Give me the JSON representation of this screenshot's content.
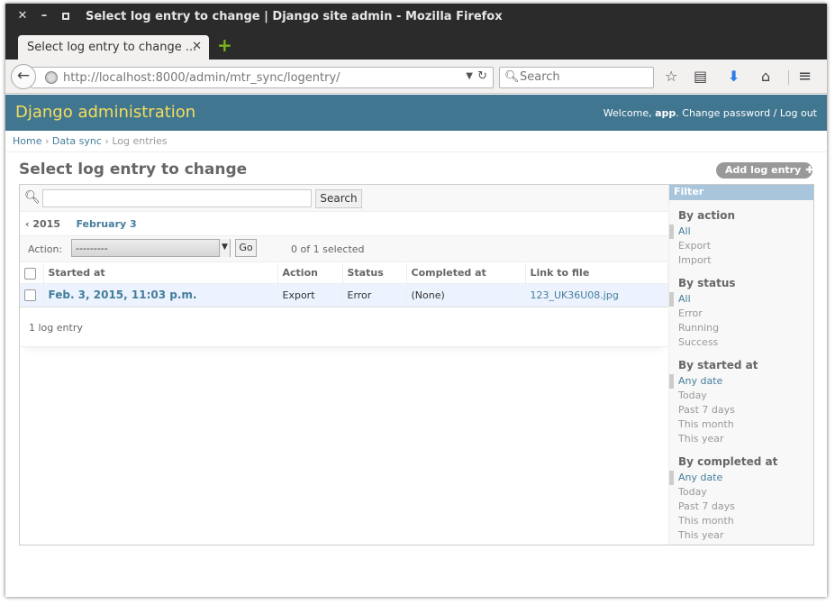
{
  "window": {
    "title": "Select log entry to change | Django site admin - Mozilla Firefox"
  },
  "browser": {
    "tab_label": "Select log entry to change ...",
    "url_host": "http://localhost",
    "url_rest": ":8000/admin/mtr_sync/logentry/",
    "search_placeholder": "Search"
  },
  "header": {
    "branding": "Django administration",
    "welcome": "Welcome, ",
    "username": "app",
    "change_password": "Change password",
    "separator": " / ",
    "logout": "Log out"
  },
  "breadcrumbs": {
    "home": "Home",
    "app": "Data sync",
    "current": "Log entries",
    "sep": " › "
  },
  "page": {
    "title": "Select log entry to change",
    "add_button": "Add log entry"
  },
  "toolbar": {
    "search_value": "",
    "search_button": "Search"
  },
  "date_hierarchy": {
    "back": "‹ 2015",
    "day": "February 3"
  },
  "actions": {
    "label": "Action:",
    "selected_option": "---------",
    "go": "Go",
    "selection_counter": "0 of 1 selected"
  },
  "table": {
    "headers": [
      "Started at",
      "Action",
      "Status",
      "Completed at",
      "Link to file"
    ],
    "rows": [
      {
        "started_at": "Feb. 3, 2015, 11:03 p.m.",
        "action": "Export",
        "status": "Error",
        "completed_at": "(None)",
        "link": "123_UK36U08.jpg"
      }
    ]
  },
  "paginator": "1 log entry",
  "filter": {
    "title": "Filter",
    "groups": [
      {
        "title": "By action",
        "items": [
          "All",
          "Export",
          "Import"
        ]
      },
      {
        "title": "By status",
        "items": [
          "All",
          "Error",
          "Running",
          "Success"
        ]
      },
      {
        "title": "By started at",
        "items": [
          "Any date",
          "Today",
          "Past 7 days",
          "This month",
          "This year"
        ]
      },
      {
        "title": "By completed at",
        "items": [
          "Any date",
          "Today",
          "Past 7 days",
          "This month",
          "This year"
        ]
      }
    ]
  },
  "colors": {
    "header_bg": "#417690",
    "branding": "#f5dd5d",
    "link": "#447e9b",
    "row_bg": "#edf3fe",
    "filter_title_bg": "#a8c5dc"
  }
}
